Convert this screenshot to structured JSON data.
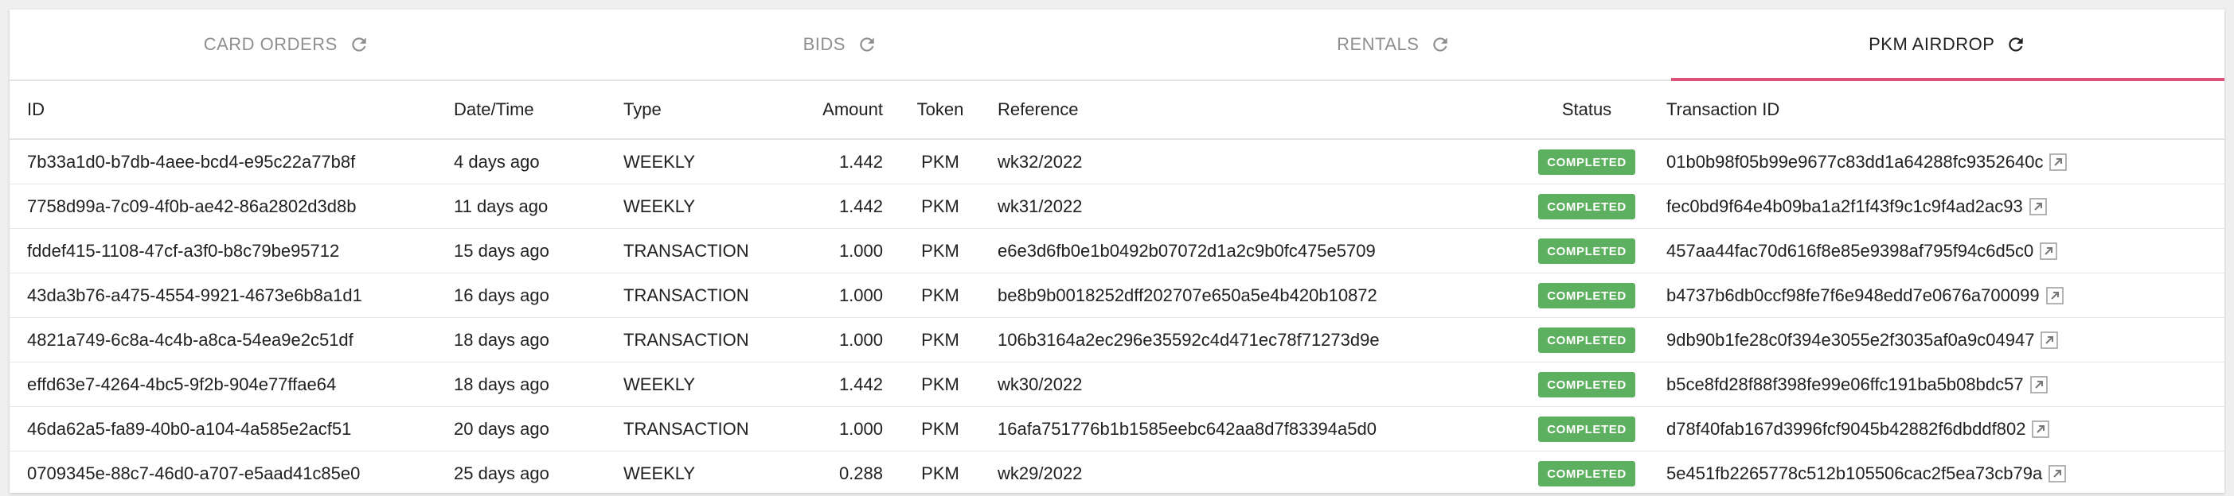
{
  "tabs": [
    {
      "label": "CARD ORDERS",
      "icon": "refresh-icon",
      "active": false
    },
    {
      "label": "BIDS",
      "icon": "refresh-icon",
      "active": false
    },
    {
      "label": "RENTALS",
      "icon": "refresh-icon",
      "active": false
    },
    {
      "label": "PKM AIRDROP",
      "icon": "refresh-icon",
      "active": true
    }
  ],
  "table": {
    "headers": {
      "id": "ID",
      "datetime": "Date/Time",
      "type": "Type",
      "amount": "Amount",
      "token": "Token",
      "reference": "Reference",
      "status": "Status",
      "txid": "Transaction ID"
    },
    "rows": [
      {
        "id": "7b33a1d0-b7db-4aee-bcd4-e95c22a77b8f",
        "datetime": "4 days ago",
        "type": "WEEKLY",
        "amount": "1.442",
        "token": "PKM",
        "reference": "wk32/2022",
        "status": "COMPLETED",
        "txid": "01b0b98f05b99e9677c83dd1a64288fc9352640c"
      },
      {
        "id": "7758d99a-7c09-4f0b-ae42-86a2802d3d8b",
        "datetime": "11 days ago",
        "type": "WEEKLY",
        "amount": "1.442",
        "token": "PKM",
        "reference": "wk31/2022",
        "status": "COMPLETED",
        "txid": "fec0bd9f64e4b09ba1a2f1f43f9c1c9f4ad2ac93"
      },
      {
        "id": "fddef415-1108-47cf-a3f0-b8c79be95712",
        "datetime": "15 days ago",
        "type": "TRANSACTION",
        "amount": "1.000",
        "token": "PKM",
        "reference": "e6e3d6fb0e1b0492b07072d1a2c9b0fc475e5709",
        "status": "COMPLETED",
        "txid": "457aa44fac70d616f8e85e9398af795f94c6d5c0"
      },
      {
        "id": "43da3b76-a475-4554-9921-4673e6b8a1d1",
        "datetime": "16 days ago",
        "type": "TRANSACTION",
        "amount": "1.000",
        "token": "PKM",
        "reference": "be8b9b0018252dff202707e650a5e4b420b10872",
        "status": "COMPLETED",
        "txid": "b4737b6db0ccf98fe7f6e948edd7e0676a700099"
      },
      {
        "id": "4821a749-6c8a-4c4b-a8ca-54ea9e2c51df",
        "datetime": "18 days ago",
        "type": "TRANSACTION",
        "amount": "1.000",
        "token": "PKM",
        "reference": "106b3164a2ec296e35592c4d471ec78f71273d9e",
        "status": "COMPLETED",
        "txid": "9db90b1fe28c0f394e3055e2f3035af0a9c04947"
      },
      {
        "id": "effd63e7-4264-4bc5-9f2b-904e77ffae64",
        "datetime": "18 days ago",
        "type": "WEEKLY",
        "amount": "1.442",
        "token": "PKM",
        "reference": "wk30/2022",
        "status": "COMPLETED",
        "txid": "b5ce8fd28f88f398fe99e06ffc191ba5b08bdc57"
      },
      {
        "id": "46da62a5-fa89-40b0-a104-4a585e2acf51",
        "datetime": "20 days ago",
        "type": "TRANSACTION",
        "amount": "1.000",
        "token": "PKM",
        "reference": "16afa751776b1b1585eebc642aa8d7f83394a5d0",
        "status": "COMPLETED",
        "txid": "d78f40fab167d3996fcf9045b42882f6dbddf802"
      },
      {
        "id": "0709345e-88c7-46d0-a707-e5aad41c85e0",
        "datetime": "25 days ago",
        "type": "WEEKLY",
        "amount": "0.288",
        "token": "PKM",
        "reference": "wk29/2022",
        "status": "COMPLETED",
        "txid": "5e451fb2265778c512b105506cac2f5ea73cb79a"
      }
    ]
  },
  "colors": {
    "active_tab_underline": "#e0507a",
    "status_completed": "#5cb05f"
  }
}
